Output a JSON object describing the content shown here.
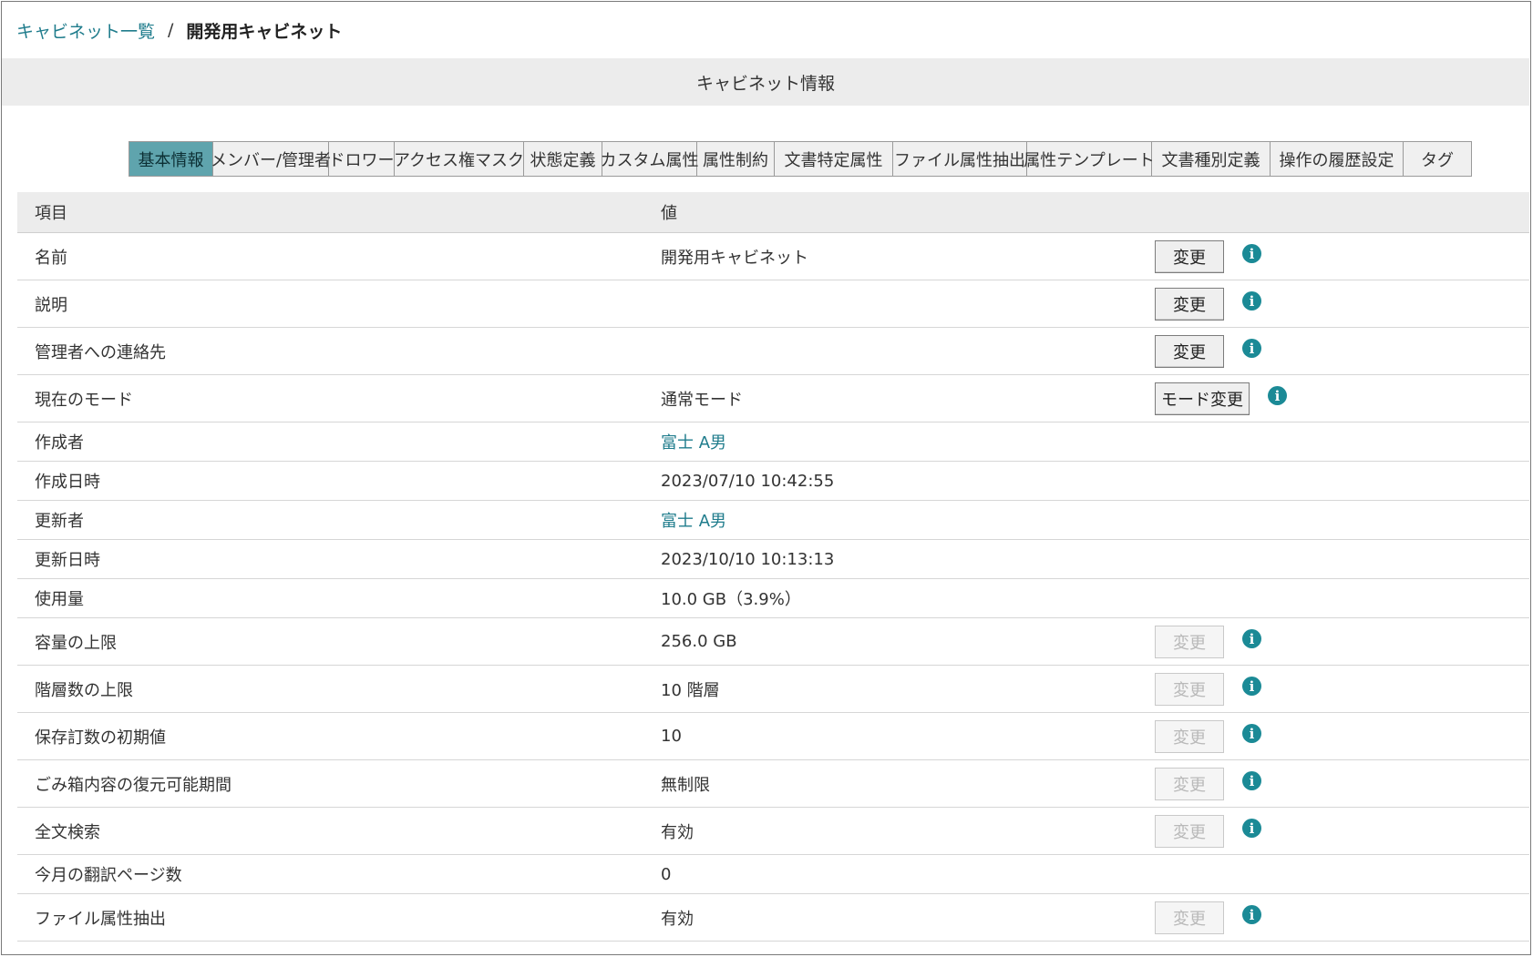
{
  "breadcrumb": {
    "parent": "キャビネット一覧",
    "separator": "/",
    "current": "開発用キャビネット"
  },
  "section_title": "キャビネット情報",
  "tabs": [
    {
      "label": "基本情報",
      "active": true
    },
    {
      "label": "メンバー/管理者",
      "active": false
    },
    {
      "label": "ドロワー",
      "active": false
    },
    {
      "label": "アクセス権マスク",
      "active": false
    },
    {
      "label": "状態定義",
      "active": false
    },
    {
      "label": "カスタム属性",
      "active": false
    },
    {
      "label": "属性制約",
      "active": false
    },
    {
      "label": "文書特定属性",
      "active": false
    },
    {
      "label": "ファイル属性抽出",
      "active": false
    },
    {
      "label": "属性テンプレート",
      "active": false
    },
    {
      "label": "文書種別定義",
      "active": false
    },
    {
      "label": "操作の履歴設定",
      "active": false
    },
    {
      "label": "タグ",
      "active": false
    }
  ],
  "table": {
    "headers": {
      "item": "項目",
      "value": "値"
    },
    "rows": [
      {
        "item": "名前",
        "value": "開発用キャビネット",
        "button": "変更",
        "enabled": true
      },
      {
        "item": "説明",
        "value": "",
        "button": "変更",
        "enabled": true
      },
      {
        "item": "管理者への連絡先",
        "value": "",
        "button": "変更",
        "enabled": true
      },
      {
        "item": "現在のモード",
        "value": "通常モード",
        "button": "モード変更",
        "enabled": true
      },
      {
        "item": "作成者",
        "value": "富士 A男",
        "link": true
      },
      {
        "item": "作成日時",
        "value": "2023/07/10 10:42:55"
      },
      {
        "item": "更新者",
        "value": "富士 A男",
        "link": true
      },
      {
        "item": "更新日時",
        "value": "2023/10/10 10:13:13"
      },
      {
        "item": "使用量",
        "value": "10.0 GB（3.9%）"
      },
      {
        "item": "容量の上限",
        "value": "256.0 GB",
        "button": "変更",
        "enabled": false
      },
      {
        "item": "階層数の上限",
        "value": "10 階層",
        "button": "変更",
        "enabled": false
      },
      {
        "item": "保存訂数の初期値",
        "value": "10",
        "button": "変更",
        "enabled": false
      },
      {
        "item": "ごみ箱内容の復元可能期間",
        "value": "無制限",
        "button": "変更",
        "enabled": false
      },
      {
        "item": "全文検索",
        "value": "有効",
        "button": "変更",
        "enabled": false
      },
      {
        "item": "今月の翻訳ページ数",
        "value": "0"
      },
      {
        "item": "ファイル属性抽出",
        "value": "有効",
        "button": "変更",
        "enabled": false
      }
    ]
  },
  "icons": {
    "info": "info-icon"
  },
  "colors": {
    "accent": "#1f7c8c",
    "active_tab": "#5fa4ad",
    "info_icon": "#1b8a96"
  }
}
